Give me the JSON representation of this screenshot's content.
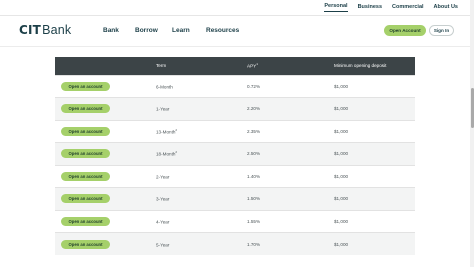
{
  "utility_nav": {
    "items": [
      "Personal",
      "Business",
      "Commercial",
      "About Us"
    ],
    "active": "Personal"
  },
  "brand": {
    "logo_cit": "CIT",
    "logo_bank": "Bank"
  },
  "main_nav": [
    "Bank",
    "Borrow",
    "Learn",
    "Resources"
  ],
  "header_buttons": {
    "open_account": "Open Account",
    "sign_in": "Sign In"
  },
  "colors": {
    "accent_green": "#a5d06a",
    "brand_teal": "#1c3f48",
    "table_header": "#3c4447"
  },
  "table": {
    "headers": [
      "",
      "Term",
      "APY",
      "Minimum opening deposit"
    ],
    "header_sup": {
      "apy": "1"
    },
    "rows": [
      {
        "action": "Open an account",
        "term": "6-Month",
        "term_sup": "",
        "apy": "0.72%",
        "deposit": "$1,000"
      },
      {
        "action": "Open an account",
        "term": "1-Year",
        "term_sup": "",
        "apy": "2.20%",
        "deposit": "$1,000"
      },
      {
        "action": "Open an account",
        "term": "13-Month",
        "term_sup": "2",
        "apy": "2.35%",
        "deposit": "$1,000"
      },
      {
        "action": "Open an account",
        "term": "18-Month",
        "term_sup": "2",
        "apy": "2.50%",
        "deposit": "$1,000"
      },
      {
        "action": "Open an account",
        "term": "2-Year",
        "term_sup": "",
        "apy": "1.40%",
        "deposit": "$1,000"
      },
      {
        "action": "Open an account",
        "term": "3-Year",
        "term_sup": "",
        "apy": "1.50%",
        "deposit": "$1,000"
      },
      {
        "action": "Open an account",
        "term": "4-Year",
        "term_sup": "",
        "apy": "1.55%",
        "deposit": "$1,000"
      },
      {
        "action": "Open an account",
        "term": "5-Year",
        "term_sup": "",
        "apy": "1.70%",
        "deposit": "$1,000"
      }
    ]
  }
}
